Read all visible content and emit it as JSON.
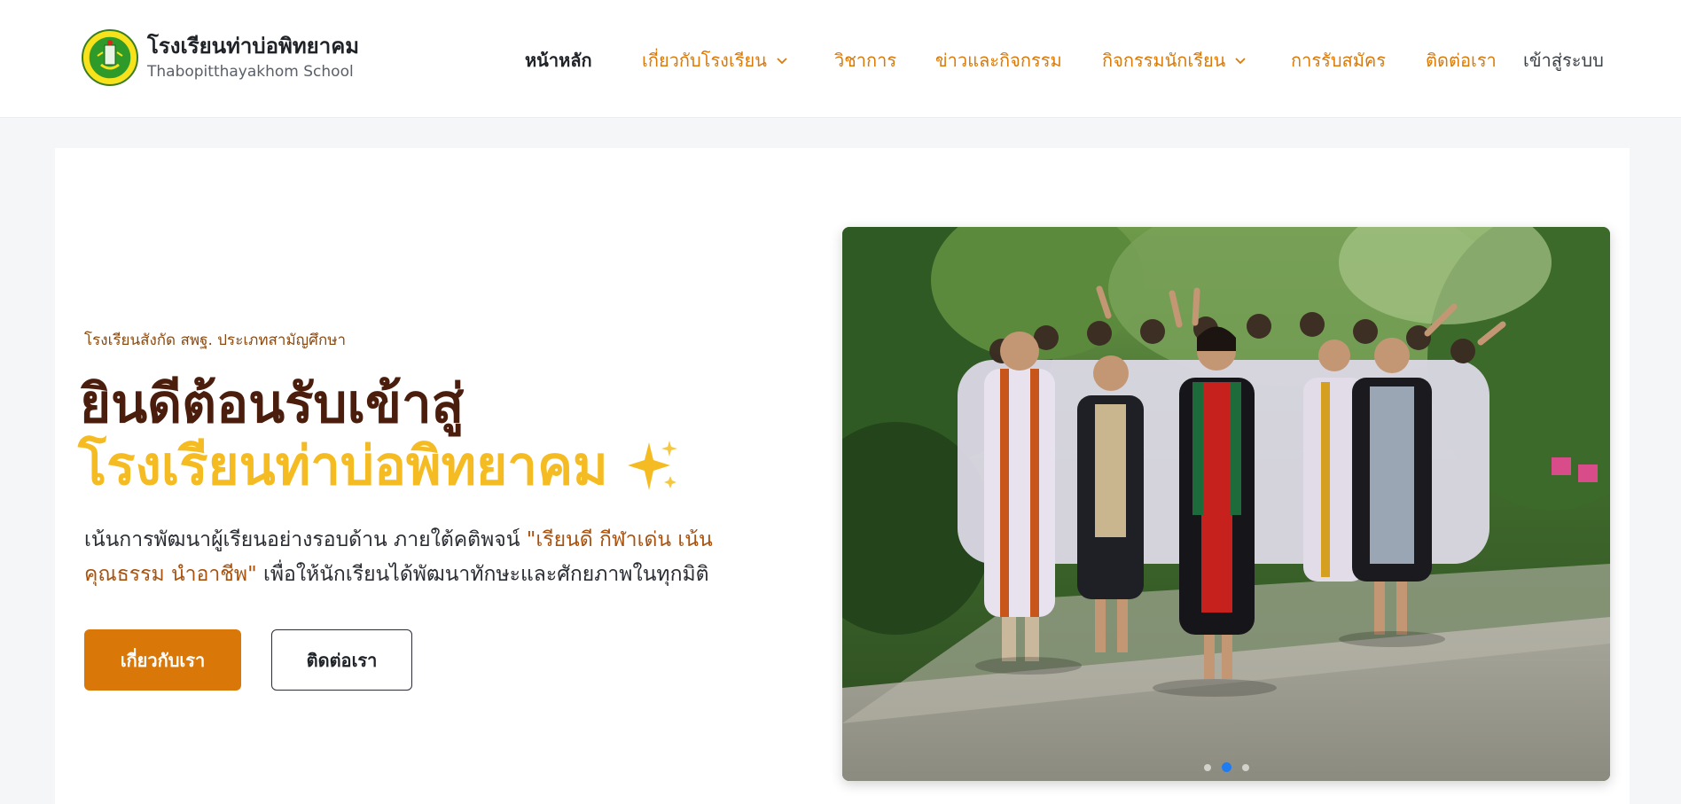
{
  "header": {
    "school_name": "โรงเรียนท่าบ่อพิทยาคม",
    "school_name_en": "Thabopitthayakhom School",
    "logo_icon": "school-crest-icon"
  },
  "nav": {
    "items": [
      {
        "label": "หน้าหลัก",
        "active": true
      },
      {
        "label": "เกี่ยวกับโรงเรียน",
        "dropdown": true
      },
      {
        "label": "วิชาการ"
      },
      {
        "label": "ข่าวและกิจกรรม"
      },
      {
        "label": "กิจกรรมนักเรียน",
        "dropdown": true
      },
      {
        "label": "การรับสมัคร"
      },
      {
        "label": "ติดต่อเรา"
      }
    ],
    "login_label": "เข้าสู่ระบบ"
  },
  "hero": {
    "eyebrow": "โรงเรียนสังกัด สพฐ. ประเภทสามัญศึกษา",
    "title_line1": "ยินดีต้อนรับเข้าสู่",
    "title_line2": "โรงเรียนท่าบ่อพิทยาคม",
    "desc_part1": "เน้นการพัฒนาผู้เรียนอย่างรอบด้าน ภายใต้คติพจน์ ",
    "desc_motto": "\"เรียนดี กีฬาเด่น เน้นคุณธรรม นำอาชีพ\"",
    "desc_part2": " เพื่อให้นักเรียนได้พัฒนาทักษะและศักยภาพในทุกมิติ",
    "primary_button": "เกี่ยวกับเรา",
    "secondary_button": "ติดต่อเรา"
  },
  "carousel": {
    "slide_count": 3,
    "active_index": 1
  },
  "colors": {
    "accent": "#d97708",
    "title_dark": "#4a1d0c",
    "title_gold": "#f5bb22",
    "dot_active": "#1e7cf2"
  }
}
